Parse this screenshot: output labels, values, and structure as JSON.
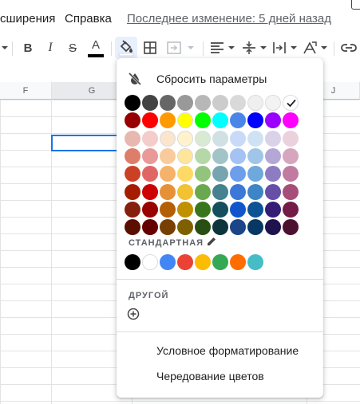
{
  "menubar": {
    "extensions": "сширения",
    "help": "Справка",
    "last_edit": "Последнее изменение: 5 дней назад"
  },
  "toolbar": {
    "bold": "B",
    "italic": "I",
    "strike": "S",
    "text_color": "A",
    "text_color_bar": "#000000",
    "icons": [
      "chevron-down-icon",
      "bold-icon",
      "italic-icon",
      "strikethrough-icon",
      "text-color-icon",
      "fill-color-icon",
      "borders-icon",
      "merge-cells-icon",
      "align-left-icon",
      "vertical-align-icon",
      "text-wrap-icon",
      "text-rotate-icon",
      "link-icon"
    ]
  },
  "sheet": {
    "columns": [
      "F",
      "G",
      "",
      "J"
    ],
    "selected_column": "G"
  },
  "fill_menu": {
    "reset": "Сбросить параметры",
    "custom_label": "СТАНДАРТНАЯ",
    "other_label": "ДРУГОЙ",
    "conditional_formatting": "Условное форматирование",
    "alternating_colors": "Чередование цветов",
    "selected_color": "#ffffff",
    "palette": [
      [
        "#000000",
        "#434343",
        "#666666",
        "#999999",
        "#b7b7b7",
        "#cccccc",
        "#d9d9d9",
        "#efefef",
        "#f3f3f3",
        "#ffffff"
      ],
      [
        "#980000",
        "#ff0000",
        "#ff9900",
        "#ffff00",
        "#00ff00",
        "#00ffff",
        "#4a86e8",
        "#0000ff",
        "#9900ff",
        "#ff00ff"
      ],
      [
        "#e6b8af",
        "#f4cccc",
        "#fce5cd",
        "#fff2cc",
        "#d9ead3",
        "#d0e0e3",
        "#c9daf8",
        "#cfe2f3",
        "#d9d2e9",
        "#ead1dc"
      ],
      [
        "#dd7e6b",
        "#ea9999",
        "#f9cb9c",
        "#ffe599",
        "#b6d7a8",
        "#a2c4c9",
        "#a4c2f4",
        "#9fc5e8",
        "#b4a7d6",
        "#d5a6bd"
      ],
      [
        "#cc4125",
        "#e06666",
        "#f6b26b",
        "#ffd966",
        "#93c47d",
        "#76a5af",
        "#6d9eeb",
        "#6fa8dc",
        "#8e7cc3",
        "#c27ba0"
      ],
      [
        "#a61c00",
        "#cc0000",
        "#e69138",
        "#f1c232",
        "#6aa84f",
        "#45818e",
        "#3c78d8",
        "#3d85c6",
        "#674ea7",
        "#a64d79"
      ],
      [
        "#85200c",
        "#990000",
        "#b45f06",
        "#bf9000",
        "#38761d",
        "#134f5c",
        "#1155cc",
        "#0b5394",
        "#351c75",
        "#741b47"
      ],
      [
        "#5b0f00",
        "#660000",
        "#783f04",
        "#7f6000",
        "#274e13",
        "#0c343d",
        "#1c4587",
        "#073763",
        "#20124d",
        "#4c1130"
      ]
    ],
    "theme_colors": [
      "#000000",
      "#ffffff",
      "#4285f4",
      "#ea4335",
      "#fbbc04",
      "#34a853",
      "#ff6d01",
      "#46bdc6"
    ]
  }
}
